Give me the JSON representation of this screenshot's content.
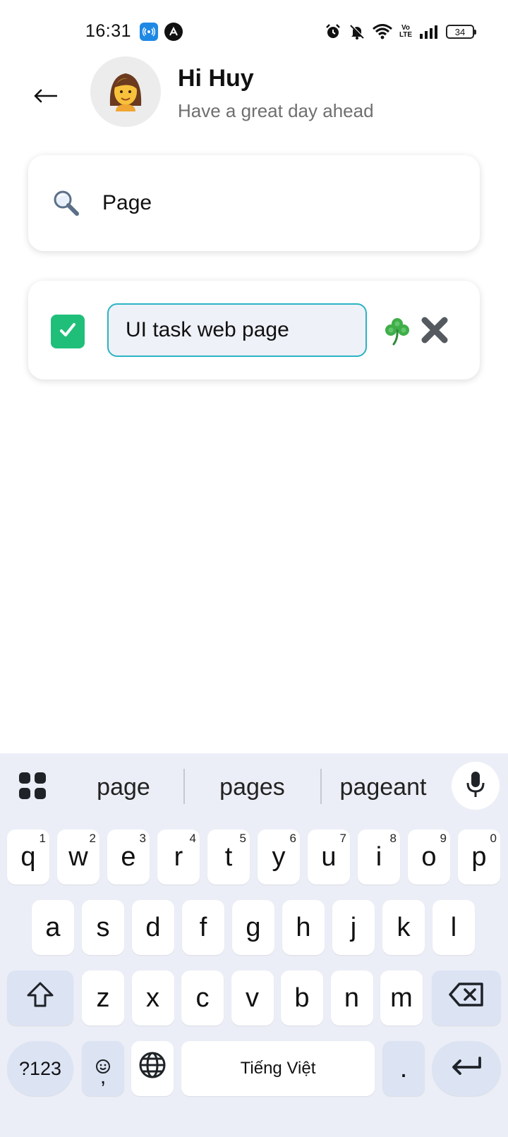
{
  "status_bar": {
    "time": "16:31",
    "network_label": "Vo LTE",
    "battery_level": "34",
    "icons": [
      "hotspot-icon",
      "app-a-icon",
      "alarm-icon",
      "bell-muted-icon",
      "wifi-icon",
      "volte-icon",
      "signal-icon",
      "battery-icon"
    ]
  },
  "header": {
    "back_icon": "arrow-left-icon",
    "avatar_icon": "woman-avatar-icon",
    "title": "Hi Huy",
    "subtitle": "Have a great day ahead"
  },
  "search": {
    "icon": "magnifier-icon",
    "value": "Page"
  },
  "tasks": [
    {
      "checked": true,
      "text": "UI task web page",
      "actions": [
        "clover-icon",
        "close-x-icon"
      ]
    }
  ],
  "keyboard": {
    "suggestions": [
      "page",
      "pages",
      "pageant"
    ],
    "row1": [
      {
        "key": "q",
        "hint": "1"
      },
      {
        "key": "w",
        "hint": "2"
      },
      {
        "key": "e",
        "hint": "3"
      },
      {
        "key": "r",
        "hint": "4"
      },
      {
        "key": "t",
        "hint": "5"
      },
      {
        "key": "y",
        "hint": "6"
      },
      {
        "key": "u",
        "hint": "7"
      },
      {
        "key": "i",
        "hint": "8"
      },
      {
        "key": "o",
        "hint": "9"
      },
      {
        "key": "p",
        "hint": "0"
      }
    ],
    "row2": [
      "a",
      "s",
      "d",
      "f",
      "g",
      "h",
      "j",
      "k",
      "l"
    ],
    "row3": [
      "z",
      "x",
      "c",
      "v",
      "b",
      "n",
      "m"
    ],
    "symbols_label": "?123",
    "comma_label": ",",
    "space_label": "Tiếng Việt",
    "period_label": ".",
    "colors": {
      "background": "#eceef7",
      "key": "#ffffff",
      "function_key": "#dce3f3"
    }
  },
  "colors": {
    "checkbox": "#1fbf7a",
    "input_border": "#2bb3c4",
    "input_fill": "#eef1f8",
    "subtitle": "#6f6f6f"
  }
}
